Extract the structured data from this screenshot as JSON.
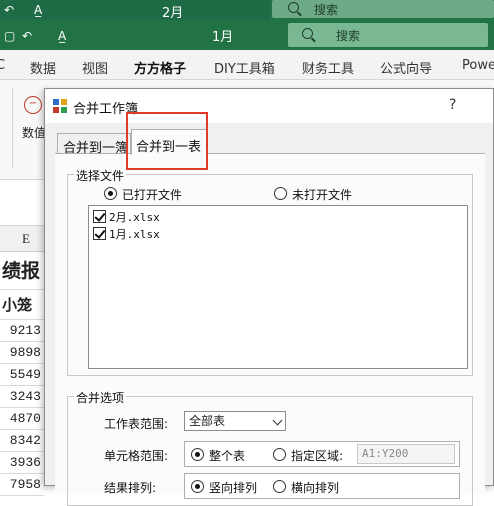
{
  "excel": {
    "back_title": {
      "month": "2月",
      "search": "搜索"
    },
    "front_title": {
      "month": "1月",
      "search": "搜索"
    },
    "ribbon_tabs": [
      {
        "label": "C"
      },
      {
        "label": "数据"
      },
      {
        "label": "视图"
      },
      {
        "label": "方方格子",
        "active": true
      },
      {
        "label": "DIY工具箱"
      },
      {
        "label": "财务工具"
      },
      {
        "label": "公式向导"
      },
      {
        "label": "Powe"
      }
    ],
    "ribbon_group_label": "数值",
    "col_header": "E",
    "cell_title": "绩报",
    "cell_header": "小笼",
    "cell_values": [
      "9213",
      "9898",
      "5549",
      "3243",
      "4870",
      "8342",
      "3936",
      "7958",
      "7561"
    ]
  },
  "dialog": {
    "title": "合并工作簿",
    "help": "?",
    "tabs": [
      {
        "label": "合并到一簿",
        "selected": false
      },
      {
        "label": "合并到一表",
        "selected": true
      }
    ],
    "select_files": {
      "legend": "选择文件",
      "opened_label": "已打开文件",
      "unopened_label": "未打开文件",
      "selected_option": "opened",
      "files": [
        {
          "name": "2月.xlsx",
          "checked": true
        },
        {
          "name": "1月.xlsx",
          "checked": true
        }
      ]
    },
    "merge_options": {
      "legend": "合并选项",
      "sheet_range_label": "工作表范围:",
      "sheet_range_value": "全部表",
      "cell_range_label": "单元格范围:",
      "whole_sheet_label": "整个表",
      "specified_area_label": "指定区域:",
      "specified_area_value": "A1:Y200",
      "cell_range_selected": "whole",
      "result_order_label": "结果排列:",
      "vertical_label": "竖向排列",
      "horizontal_label": "横向排列",
      "result_order_selected": "vertical"
    }
  },
  "colors": {
    "excel_green": "#217346",
    "highlight": "#e33a2e"
  }
}
